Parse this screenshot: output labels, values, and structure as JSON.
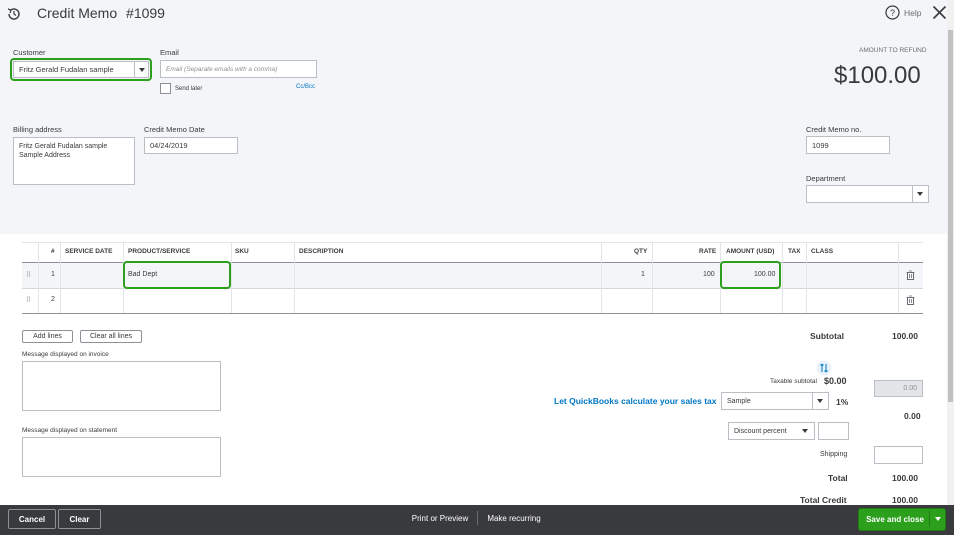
{
  "header": {
    "title": "Credit Memo",
    "number": "#1099",
    "help_label": "Help"
  },
  "customer": {
    "label": "Customer",
    "value": "Fritz Gerald Fudalan sample"
  },
  "email": {
    "label": "Email",
    "placeholder": "Email (Separate emails with a comma)",
    "send_later_label": "Send later",
    "ccbcc_label": "Cc/Bcc"
  },
  "refund": {
    "label": "AMOUNT TO REFUND",
    "amount": "$100.00"
  },
  "billing": {
    "label": "Billing address",
    "line1": "Fritz Gerald Fudalan sample",
    "line2": "Sample Address"
  },
  "memo_date": {
    "label": "Credit Memo Date",
    "value": "04/24/2019"
  },
  "memo_no": {
    "label": "Credit Memo no.",
    "value": "1099"
  },
  "department": {
    "label": "Department",
    "value": ""
  },
  "table": {
    "columns": {
      "num": "#",
      "service_date": "SERVICE DATE",
      "product": "PRODUCT/SERVICE",
      "sku": "SKU",
      "description": "DESCRIPTION",
      "qty": "QTY",
      "rate": "RATE",
      "amount": "AMOUNT (USD)",
      "tax": "TAX",
      "class": "CLASS"
    },
    "rows": [
      {
        "num": "1",
        "product": "Bad Dept",
        "qty": "1",
        "rate": "100",
        "amount": "100.00"
      },
      {
        "num": "2",
        "product": "",
        "qty": "",
        "rate": "",
        "amount": ""
      }
    ]
  },
  "actions": {
    "add_lines": "Add lines",
    "clear_all_lines": "Clear all lines"
  },
  "messages": {
    "invoice_label": "Message displayed on invoice",
    "statement_label": "Message displayed on statement"
  },
  "totals": {
    "subtotal_label": "Subtotal",
    "subtotal_value": "100.00",
    "taxable_subtotal_label": "Taxable subtotal",
    "taxable_subtotal_value": "$0.00",
    "sales_tax_link": "Let QuickBooks calculate your sales tax",
    "tax_rate_select": "Sample",
    "tax_rate_percent": "1%",
    "tax_amount_input": "0.00",
    "tax_amount": "0.00",
    "discount_select": "Discount percent",
    "shipping_label": "Shipping",
    "total_label": "Total",
    "total_value": "100.00",
    "total_credit_label": "Total Credit",
    "total_credit_value": "100.00"
  },
  "footer": {
    "cancel": "Cancel",
    "clear": "Clear",
    "print_preview": "Print or Preview",
    "make_recurring": "Make recurring",
    "save_close": "Save and close"
  },
  "colors": {
    "accent_green": "#2ca01c",
    "link_blue": "#0077c5",
    "footer_bg": "#393a3d",
    "panel_bg": "#f4f5f8"
  }
}
